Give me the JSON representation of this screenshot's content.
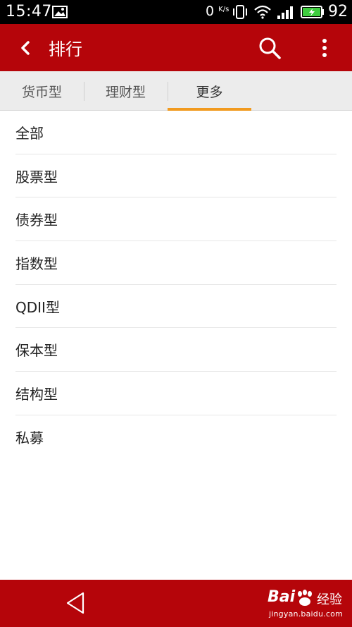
{
  "status_bar": {
    "time": "15:47",
    "net_speed": "0",
    "net_unit": "K/s",
    "battery_level": "92"
  },
  "toolbar": {
    "title": "排行"
  },
  "tabs": [
    {
      "label": "货币型",
      "active": false
    },
    {
      "label": "理财型",
      "active": false
    },
    {
      "label": "更多",
      "active": true
    }
  ],
  "list": [
    {
      "label": "全部"
    },
    {
      "label": "股票型"
    },
    {
      "label": "债券型"
    },
    {
      "label": "指数型"
    },
    {
      "label": "QDII型"
    },
    {
      "label": "保本型"
    },
    {
      "label": "结构型"
    },
    {
      "label": "私募"
    }
  ],
  "watermark": {
    "brand": "Bai",
    "jingyan": "经验",
    "url": "jingyan.baidu.com"
  },
  "colors": {
    "brand_red": "#b5050a",
    "tab_indicator": "#f19a1f"
  }
}
